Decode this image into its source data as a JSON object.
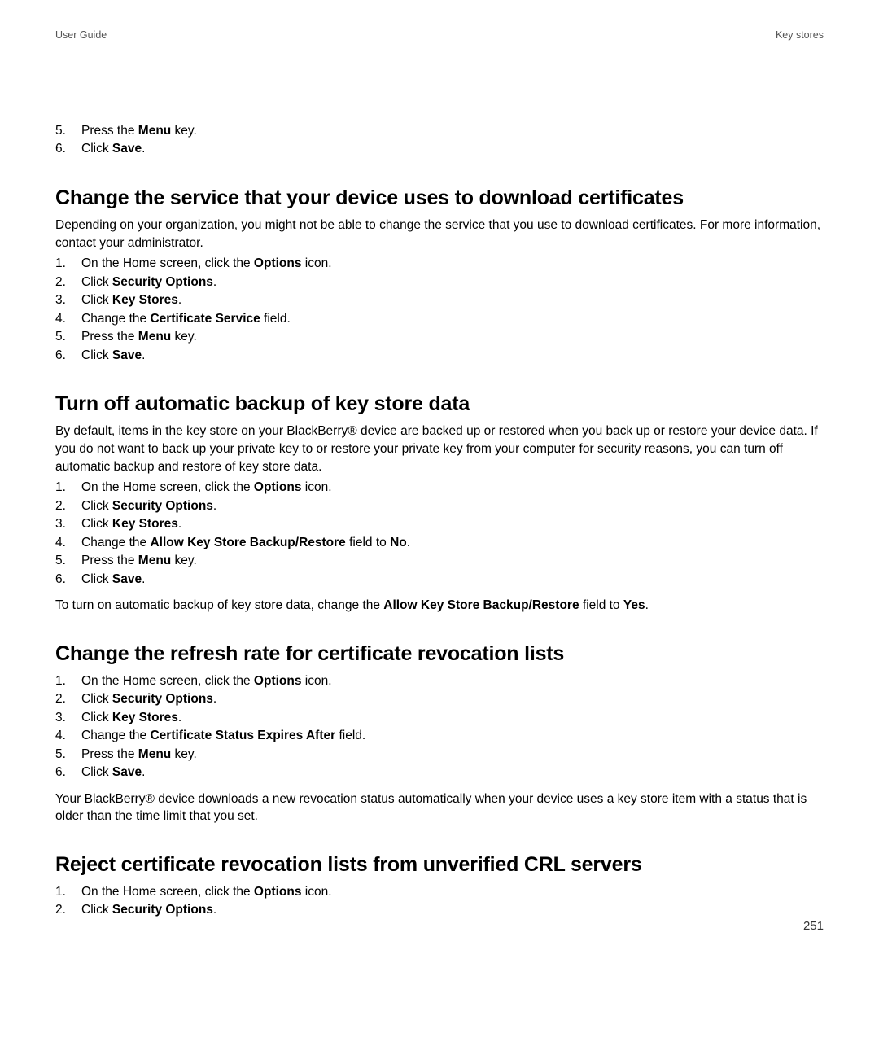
{
  "header": {
    "left": "User Guide",
    "right": "Key stores"
  },
  "intro_steps": [
    {
      "pre": "Press the ",
      "b": "Menu",
      "post": " key."
    },
    {
      "pre": "Click ",
      "b": "Save",
      "post": "."
    }
  ],
  "sections": [
    {
      "heading": "Change the service that your device uses to download certificates",
      "desc": "Depending on your organization, you might not be able to change the service that you use to download certificates. For more information, contact your administrator.",
      "steps": [
        {
          "pre": "On the Home screen, click the ",
          "b": "Options",
          "post": " icon."
        },
        {
          "pre": "Click ",
          "b": "Security Options",
          "post": "."
        },
        {
          "pre": "Click ",
          "b": "Key Stores",
          "post": "."
        },
        {
          "pre": "Change the ",
          "b": "Certificate Service",
          "post": " field."
        },
        {
          "pre": "Press the ",
          "b": "Menu",
          "post": " key."
        },
        {
          "pre": "Click ",
          "b": "Save",
          "post": "."
        }
      ]
    },
    {
      "heading": "Turn off automatic backup of key store data",
      "desc": "By default, items in the key store on your BlackBerry® device are backed up or restored when you back up or restore your device data. If you do not want to back up your private key to or restore your private key from your computer for security reasons, you can turn off automatic backup and restore of key store data.",
      "steps": [
        {
          "pre": "On the Home screen, click the ",
          "b": "Options",
          "post": " icon."
        },
        {
          "pre": "Click ",
          "b": "Security Options",
          "post": "."
        },
        {
          "pre": "Click ",
          "b": "Key Stores",
          "post": "."
        },
        {
          "pre": "Change the ",
          "b": "Allow Key Store Backup/Restore",
          "post": " field to ",
          "b2": "No",
          "post2": "."
        },
        {
          "pre": "Press the ",
          "b": "Menu",
          "post": " key."
        },
        {
          "pre": "Click ",
          "b": "Save",
          "post": "."
        }
      ],
      "follow_pre": "To turn on automatic backup of key store data, change the ",
      "follow_b": "Allow Key Store Backup/Restore",
      "follow_mid": " field to ",
      "follow_b2": "Yes",
      "follow_post": "."
    },
    {
      "heading": "Change the refresh rate for certificate revocation lists",
      "steps": [
        {
          "pre": "On the Home screen, click the ",
          "b": "Options",
          "post": " icon."
        },
        {
          "pre": "Click ",
          "b": "Security Options",
          "post": "."
        },
        {
          "pre": "Click ",
          "b": "Key Stores",
          "post": "."
        },
        {
          "pre": "Change the ",
          "b": "Certificate Status Expires After",
          "post": " field."
        },
        {
          "pre": "Press the ",
          "b": "Menu",
          "post": " key."
        },
        {
          "pre": "Click ",
          "b": "Save",
          "post": "."
        }
      ],
      "follow_plain": "Your BlackBerry® device downloads a new revocation status automatically when your device uses a key store item with a status that is older than the time limit that you set."
    },
    {
      "heading": "Reject certificate revocation lists from unverified CRL servers",
      "steps": [
        {
          "pre": "On the Home screen, click the ",
          "b": "Options",
          "post": " icon."
        },
        {
          "pre": "Click ",
          "b": "Security Options",
          "post": "."
        }
      ]
    }
  ],
  "page_number": "251"
}
